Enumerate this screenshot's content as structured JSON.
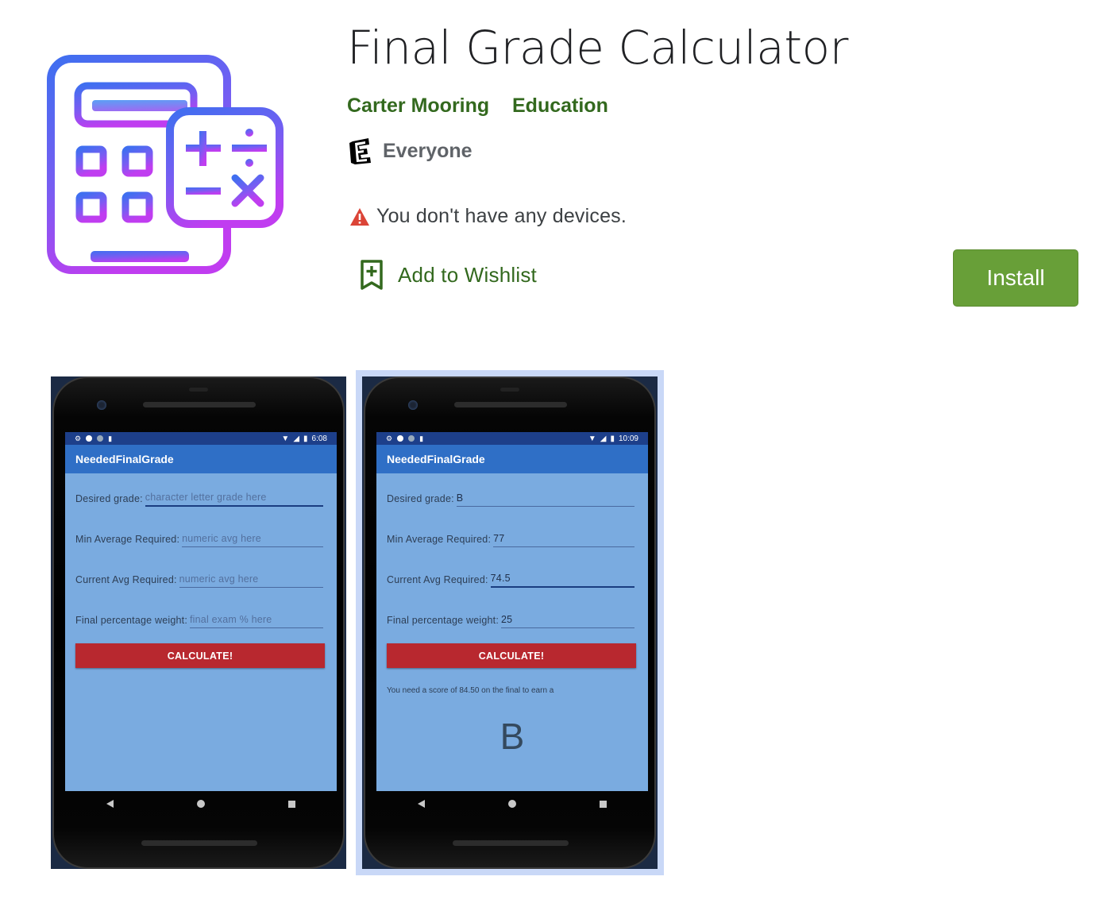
{
  "app": {
    "title": "Final Grade Calculator",
    "developer": "Carter Mooring",
    "category": "Education",
    "content_rating": "Everyone",
    "devices_notice": "You don't have any devices.",
    "wishlist_label": "Add to Wishlist",
    "install_label": "Install"
  },
  "colors": {
    "accent": "#689f38",
    "link": "#33691e",
    "warning": "#db4437"
  },
  "screenshots": [
    {
      "status_time": "6:08",
      "app_bar_title": "NeededFinalGrade",
      "fields": [
        {
          "label": "Desired grade:",
          "value": "",
          "placeholder": "character letter grade here"
        },
        {
          "label": "Min Average Required:",
          "value": "",
          "placeholder": "numeric avg here"
        },
        {
          "label": "Current Avg Required:",
          "value": "",
          "placeholder": "numeric avg here"
        },
        {
          "label": "Final percentage weight:",
          "value": "",
          "placeholder": "final exam % here"
        }
      ],
      "button_label": "CALCULATE!"
    },
    {
      "status_time": "10:09",
      "app_bar_title": "NeededFinalGrade",
      "fields": [
        {
          "label": "Desired grade:",
          "value": "B"
        },
        {
          "label": "Min Average Required:",
          "value": "77"
        },
        {
          "label": "Current Avg Required:",
          "value": "74.5"
        },
        {
          "label": "Final percentage weight:",
          "value": "25"
        }
      ],
      "button_label": "CALCULATE!",
      "result_text": "You need a score of 84.50 on the final to earn a",
      "result_grade": "B"
    }
  ],
  "icons": {
    "app_icon": "calculator-icon",
    "rating_icon": "esrb-everyone-icon",
    "warning_icon": "warning-triangle-icon",
    "wishlist_icon": "bookmark-add-icon"
  }
}
